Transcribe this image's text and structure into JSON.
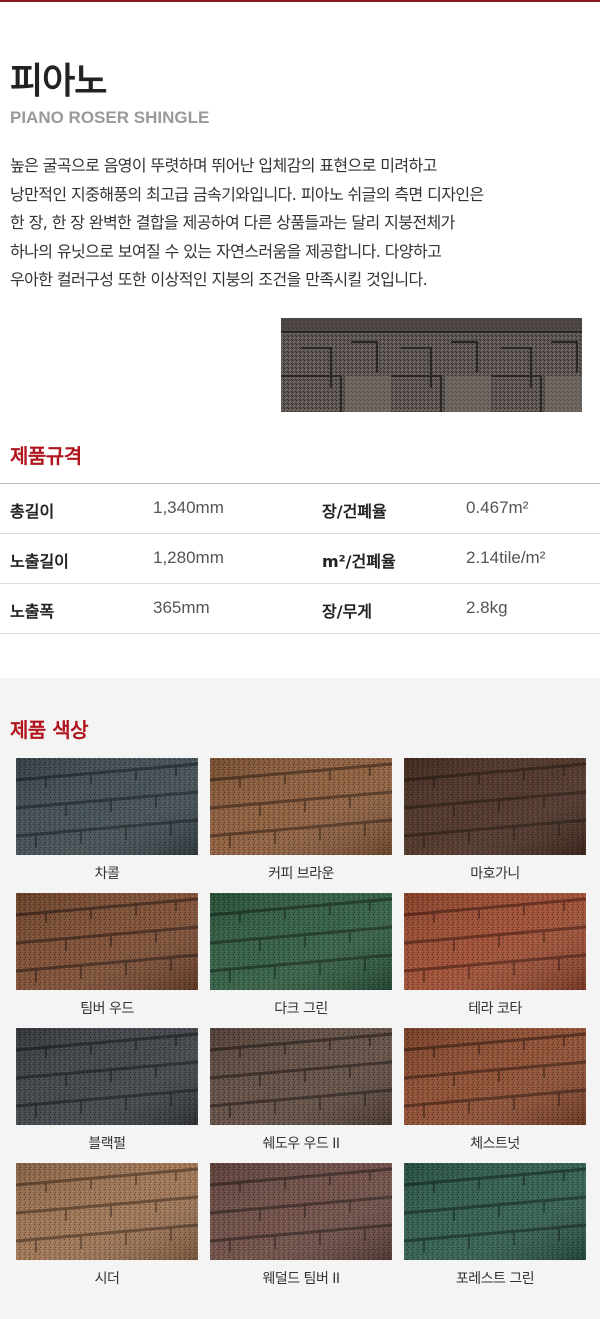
{
  "product": {
    "title": "피아노",
    "subtitle": "PIANO ROSER SHINGLE",
    "description": [
      "높은 굴곡으로 음영이 뚜렷하며 뛰어난 입체감의 표현으로 미려하고",
      "낭만적인 지중해풍의 최고급 금속기와입니다. 피아노 쉬글의 측면 디자인은",
      "한 장, 한 장 완벽한 결합을 제공하여 다른 상품들과는 달리 지붕전체가",
      "하나의 유닛으로 보여질 수 있는 자연스러움을 제공합니다. 다양하고",
      "우아한 컬러구성 또한 이상적인 지붕의 조건을 만족시킬 것입니다."
    ]
  },
  "spec": {
    "title": "제품규격",
    "rows": [
      {
        "label1": "총길이",
        "value1": "1,340mm",
        "label2": "장/건폐율",
        "value2": "0.467m²"
      },
      {
        "label1": "노출길이",
        "value1": "1,280mm",
        "label2": "m²/건폐율",
        "value2": "2.14tile/m²"
      },
      {
        "label1": "노출폭",
        "value1": "365mm",
        "label2": "장/무게",
        "value2": "2.8kg"
      }
    ]
  },
  "colors": {
    "title": "제품 색상",
    "items": [
      {
        "name": "차콜",
        "base": "#3e4a50",
        "dark": "#1f272b",
        "light": "#5a676c"
      },
      {
        "name": "커피 브라운",
        "base": "#8a5a3a",
        "dark": "#4a2e1c",
        "light": "#a87650"
      },
      {
        "name": "마호가니",
        "base": "#4a3024",
        "dark": "#2a1a12",
        "light": "#6a4634"
      },
      {
        "name": "팀버 우드",
        "base": "#7a4a30",
        "dark": "#3e2418",
        "light": "#9a6446"
      },
      {
        "name": "다크 그린",
        "base": "#2f5a40",
        "dark": "#173022",
        "light": "#467a58"
      },
      {
        "name": "테라 코타",
        "base": "#9a4a30",
        "dark": "#5a2416",
        "light": "#b86446"
      },
      {
        "name": "블랙펄",
        "base": "#3c4044",
        "dark": "#1c1f22",
        "light": "#5a5f64"
      },
      {
        "name": "쉐도우 우드 II",
        "base": "#5e4a40",
        "dark": "#2e231e",
        "light": "#7e685c"
      },
      {
        "name": "체스트넛",
        "base": "#8a4a2e",
        "dark": "#4a2414",
        "light": "#a86444"
      },
      {
        "name": "시더",
        "base": "#9a7050",
        "dark": "#5a3e28",
        "light": "#b88c66"
      },
      {
        "name": "웨덜드 팀버 II",
        "base": "#6a4a42",
        "dark": "#3a2622",
        "light": "#8a6a5e"
      },
      {
        "name": "포레스트 그린",
        "base": "#2e5a4a",
        "dark": "#163026",
        "light": "#467a66"
      }
    ]
  },
  "hero": {
    "base": "#5a524e",
    "dark": "#2e2a28",
    "light": "#7a726c"
  }
}
